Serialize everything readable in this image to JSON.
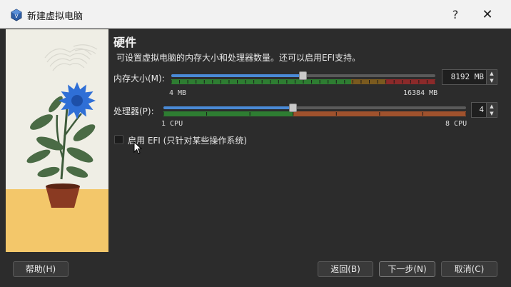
{
  "window": {
    "title": "新建虚拟电脑",
    "help_glyph": "?",
    "close_glyph": "✕"
  },
  "section": {
    "heading": "硬件",
    "description": "可设置虚拟电脑的内存大小和处理器数量。还可以启用EFI支持。"
  },
  "memory": {
    "label": "内存大小(M):",
    "min_label": "4 MB",
    "max_label": "16384 MB",
    "value_text": "8192 MB",
    "value": 8192,
    "min": 4,
    "max": 16384
  },
  "cpu": {
    "label": "处理器(P):",
    "min_label": "1 CPU",
    "max_label": "8 CPU",
    "value_text": "4",
    "value": 4,
    "min": 1,
    "max": 8
  },
  "efi": {
    "label": "启用 EFI (只针对某些操作系统)",
    "checked": false
  },
  "buttons": {
    "help": "帮助(H)",
    "back": "返回(B)",
    "next": "下一步(N)",
    "cancel": "取消(C)"
  },
  "colors": {
    "accent": "#4a8ad6",
    "range_good": "#2e7d32",
    "range_warn": "#8a6d1f",
    "range_bad": "#8b2a2a",
    "cpu_over": "#a0522d"
  }
}
